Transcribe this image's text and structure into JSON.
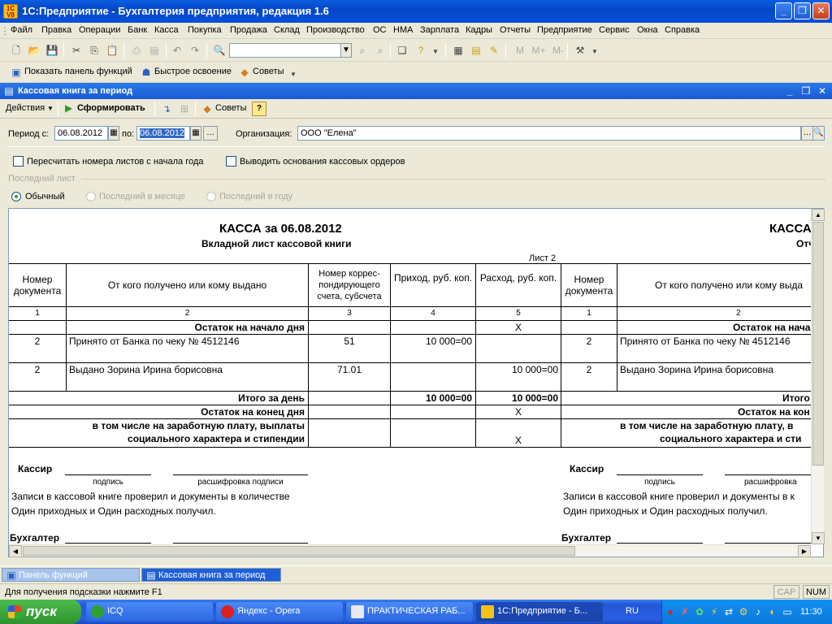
{
  "window": {
    "title": "1С:Предприятие - Бухгалтерия предприятия, редакция 1.6",
    "logo_text": "1С V8"
  },
  "menu": [
    "Файл",
    "Правка",
    "Операции",
    "Банк",
    "Касса",
    "Покупка",
    "Продажа",
    "Склад",
    "Производство",
    "ОС",
    "НМА",
    "Зарплата",
    "Кадры",
    "Отчеты",
    "Предприятие",
    "Сервис",
    "Окна",
    "Справка"
  ],
  "toolbar2": {
    "show_panel": "Показать панель функций",
    "quick_learn": "Быстрое освоение",
    "tips": "Советы"
  },
  "child": {
    "title": "Кассовая книга за период",
    "actions": "Действия",
    "generate": "Сформировать",
    "tips": "Советы",
    "help": "?"
  },
  "form": {
    "period_from_label": "Период с:",
    "period_from": "06.08.2012",
    "period_to_label": "по:",
    "period_to": "06.08.2012",
    "org_label": "Организация:",
    "org_value": "ООО \"Елена\"",
    "check_renumber": "Пересчитать номера листов с начала года",
    "check_basis": "Выводить основания кассовых ордеров",
    "last_sheet_label": "Последний лист",
    "radio_normal": "Обычный",
    "radio_month": "Последний в месяце",
    "radio_year": "Последний в году"
  },
  "report": {
    "title": "КАССА за 06.08.2012",
    "subtitle": "Вкладной лист кассовой книги",
    "sheet": "Лист 2",
    "title_right": "КАССА",
    "subtitle_right": "Отч",
    "headers": {
      "doc_no": "Номер документа",
      "from_to": "От кого получено или кому выдано",
      "account": "Номер коррес-пондирующего счета, субсчета",
      "income": "Приход, руб. коп.",
      "expense": "Расход, руб. коп.",
      "doc_no_r": "Номер документа",
      "from_to_r": "От кого получено или кому выда"
    },
    "col_nums": [
      "1",
      "2",
      "3",
      "4",
      "5",
      "1",
      "2"
    ],
    "opening_label": "Остаток на начало дня",
    "opening_label_r": "Остаток на нача",
    "opening_x": "X",
    "rows": [
      {
        "doc": "2",
        "desc": "Принято от Банка по чеку № 4512146",
        "account": "51",
        "income": "10 000=00",
        "expense": "",
        "doc_r": "2",
        "desc_r": "Принято от Банка по чеку № 4512146"
      },
      {
        "doc": "2",
        "desc": "Выдано Зорина Ирина борисовна",
        "account": "71.01",
        "income": "",
        "expense": "10 000=00",
        "doc_r": "2",
        "desc_r": "Выдано Зорина Ирина борисовна"
      }
    ],
    "total_label": "Итого за день",
    "total_income": "10 000=00",
    "total_expense": "10 000=00",
    "total_label_r": "Итого",
    "closing_label": "Остаток на конец  дня",
    "closing_label_r": "Остаток на кон",
    "closing_x": "X",
    "salary_line1": "в том числе на заработную плату, выплаты",
    "salary_line2": "социального характера и стипендии",
    "salary_line1_r": "в том числе на заработную плату, в",
    "salary_line2_r": "социального характера и сти",
    "salary_x": "X",
    "cashier": "Кассир",
    "signature": "подпись",
    "decode": "расшифровка подписи",
    "decode_r": "расшифровка",
    "checked_line1": "Записи в кассовой книге проверил и документы в количестве",
    "checked_line2": "Один приходных и Один расходных получил.",
    "checked_line1_r": "Записи в кассовой книге проверил и документы в к",
    "checked_line2_r": "Один приходных и Один расходных получил.",
    "accountant": "Бухгалтер"
  },
  "wintabs": {
    "panel": "Панель функций",
    "cashbook": "Кассовая книга за период"
  },
  "status": {
    "hint": "Для получения подсказки нажмите F1",
    "caps": "CAP",
    "num": "NUM"
  },
  "taskbar": {
    "start": "пуск",
    "tasks": [
      "ICQ",
      "Яндекс - Opera",
      "ПРАКТИЧЕСКАЯ РАБ...",
      "1С:Предприятие - Б..."
    ],
    "lang": "RU",
    "clock": "11:30"
  }
}
